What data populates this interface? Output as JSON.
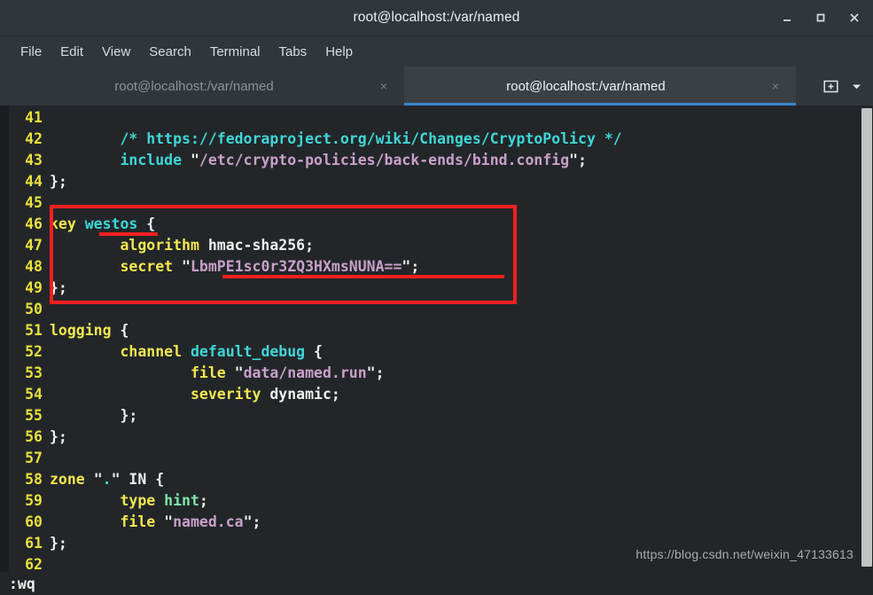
{
  "window": {
    "title": "root@localhost:/var/named",
    "controls": [
      {
        "name": "minimize",
        "glyph": "–"
      },
      {
        "name": "maximize",
        "glyph": "□"
      },
      {
        "name": "close",
        "glyph": "×"
      }
    ]
  },
  "menubar": {
    "items": [
      "File",
      "Edit",
      "View",
      "Search",
      "Terminal",
      "Tabs",
      "Help"
    ]
  },
  "tabbar": {
    "tabs": [
      {
        "label": "root@localhost:/var/named",
        "close": "×",
        "active": false
      },
      {
        "label": "root@localhost:/var/named",
        "close": "×",
        "active": true
      }
    ],
    "new_tab_icon": "new-tab-icon",
    "menu_icon": "chevron-down-icon"
  },
  "editor": {
    "first_line_number": 41,
    "lines": [
      {
        "n": "41",
        "tokens": []
      },
      {
        "n": "42",
        "tokens": [
          {
            "t": "        ",
            "c": "c-plain"
          },
          {
            "t": "/* https://fedoraproject.org/wiki/Changes/CryptoPolicy */",
            "c": "c-comment"
          }
        ]
      },
      {
        "n": "43",
        "tokens": [
          {
            "t": "        ",
            "c": "c-plain"
          },
          {
            "t": "include",
            "c": "c-ident"
          },
          {
            "t": " ",
            "c": "c-plain"
          },
          {
            "t": "\"",
            "c": "c-quote"
          },
          {
            "t": "/etc/crypto-policies/back-ends/bind.config",
            "c": "c-str"
          },
          {
            "t": "\"",
            "c": "c-quote"
          },
          {
            "t": ";",
            "c": "c-plain"
          }
        ]
      },
      {
        "n": "44",
        "tokens": [
          {
            "t": "};",
            "c": "c-plain"
          }
        ]
      },
      {
        "n": "45",
        "tokens": []
      },
      {
        "n": "46",
        "tokens": [
          {
            "t": "key",
            "c": "c-kw"
          },
          {
            "t": " ",
            "c": "c-plain"
          },
          {
            "t": "westos",
            "c": "c-ident"
          },
          {
            "t": " {",
            "c": "c-plain"
          }
        ]
      },
      {
        "n": "47",
        "tokens": [
          {
            "t": "        ",
            "c": "c-plain"
          },
          {
            "t": "algorithm",
            "c": "c-kw"
          },
          {
            "t": " hmac-sha256;",
            "c": "c-plain"
          }
        ]
      },
      {
        "n": "48",
        "tokens": [
          {
            "t": "        ",
            "c": "c-plain"
          },
          {
            "t": "secret",
            "c": "c-kw"
          },
          {
            "t": " ",
            "c": "c-plain"
          },
          {
            "t": "\"",
            "c": "c-quote"
          },
          {
            "t": "LbmPE1sc0r3ZQ3HXmsNUNA==",
            "c": "c-str"
          },
          {
            "t": "\"",
            "c": "c-quote"
          },
          {
            "t": ";",
            "c": "c-plain"
          }
        ]
      },
      {
        "n": "49",
        "tokens": [
          {
            "t": "};",
            "c": "c-plain"
          }
        ]
      },
      {
        "n": "50",
        "tokens": []
      },
      {
        "n": "51",
        "tokens": [
          {
            "t": "logging",
            "c": "c-kw"
          },
          {
            "t": " {",
            "c": "c-plain"
          }
        ]
      },
      {
        "n": "52",
        "tokens": [
          {
            "t": "        ",
            "c": "c-plain"
          },
          {
            "t": "channel",
            "c": "c-kw"
          },
          {
            "t": " ",
            "c": "c-plain"
          },
          {
            "t": "default_debug",
            "c": "c-ident"
          },
          {
            "t": " {",
            "c": "c-plain"
          }
        ]
      },
      {
        "n": "53",
        "tokens": [
          {
            "t": "                ",
            "c": "c-plain"
          },
          {
            "t": "file",
            "c": "c-kw"
          },
          {
            "t": " ",
            "c": "c-plain"
          },
          {
            "t": "\"",
            "c": "c-quote"
          },
          {
            "t": "data/named.run",
            "c": "c-str"
          },
          {
            "t": "\"",
            "c": "c-quote"
          },
          {
            "t": ";",
            "c": "c-plain"
          }
        ]
      },
      {
        "n": "54",
        "tokens": [
          {
            "t": "                ",
            "c": "c-plain"
          },
          {
            "t": "severity",
            "c": "c-kw"
          },
          {
            "t": " dynamic;",
            "c": "c-plain"
          }
        ]
      },
      {
        "n": "55",
        "tokens": [
          {
            "t": "        };",
            "c": "c-plain"
          }
        ]
      },
      {
        "n": "56",
        "tokens": [
          {
            "t": "};",
            "c": "c-plain"
          }
        ]
      },
      {
        "n": "57",
        "tokens": []
      },
      {
        "n": "58",
        "tokens": [
          {
            "t": "zone",
            "c": "c-kw"
          },
          {
            "t": " ",
            "c": "c-plain"
          },
          {
            "t": "\"",
            "c": "c-quote"
          },
          {
            "t": ".",
            "c": "c-ident"
          },
          {
            "t": "\"",
            "c": "c-quote"
          },
          {
            "t": " IN {",
            "c": "c-plain"
          }
        ]
      },
      {
        "n": "59",
        "tokens": [
          {
            "t": "        ",
            "c": "c-plain"
          },
          {
            "t": "type",
            "c": "c-kw"
          },
          {
            "t": " ",
            "c": "c-plain"
          },
          {
            "t": "hint",
            "c": "c-green"
          },
          {
            "t": ";",
            "c": "c-plain"
          }
        ]
      },
      {
        "n": "60",
        "tokens": [
          {
            "t": "        ",
            "c": "c-plain"
          },
          {
            "t": "file",
            "c": "c-kw"
          },
          {
            "t": " ",
            "c": "c-plain"
          },
          {
            "t": "\"",
            "c": "c-quote"
          },
          {
            "t": "named.ca",
            "c": "c-str"
          },
          {
            "t": "\"",
            "c": "c-quote"
          },
          {
            "t": ";",
            "c": "c-plain"
          }
        ]
      },
      {
        "n": "61",
        "tokens": [
          {
            "t": "};",
            "c": "c-plain"
          }
        ]
      },
      {
        "n": "62",
        "tokens": []
      }
    ]
  },
  "annotations": {
    "box_color": "#f41f1f",
    "underline_westos": "westos",
    "underline_secret": "LbmPE1sc0r3ZQ3HXmsNUNA=="
  },
  "watermark": {
    "text": "https://blog.csdn.net/weixin_47133613"
  },
  "statusline": {
    "text": ":wq"
  },
  "colors": {
    "titlebar_bg": "#31363b",
    "terminal_bg": "#232629",
    "active_tab_underline": "#3b85c8",
    "line_number": "#e8e03c",
    "keyword": "#f2e750",
    "identifier": "#3fd6d6",
    "string": "#c9a0c9",
    "annotation_red": "#f41f1f"
  }
}
